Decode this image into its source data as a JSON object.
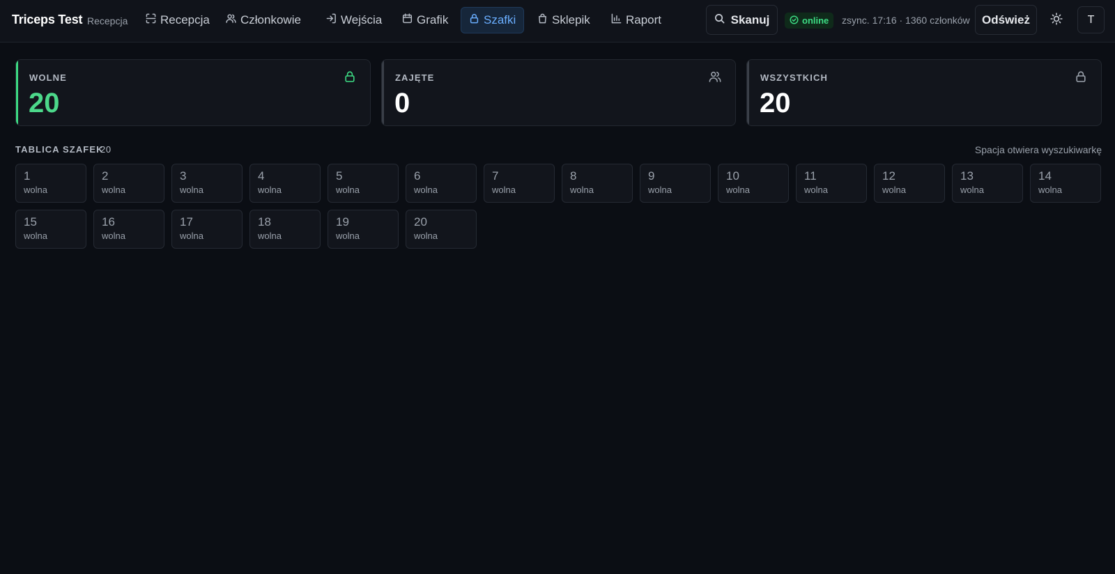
{
  "app": {
    "title": "Triceps Test",
    "subtitle": "Recepcja"
  },
  "nav": [
    {
      "label": "Recepcja",
      "icon": "scan-icon",
      "active": false
    },
    {
      "label": "Członkowie",
      "icon": "users-icon",
      "active": false
    },
    {
      "label": "Wejścia",
      "icon": "login-arrow-icon",
      "active": false
    },
    {
      "label": "Grafik",
      "icon": "calendar-icon",
      "active": false
    },
    {
      "label": "Szafki",
      "icon": "lock-icon",
      "active": true
    },
    {
      "label": "Sklepik",
      "icon": "shopping-bag-icon",
      "active": false
    },
    {
      "label": "Raport",
      "icon": "bar-chart-icon",
      "active": false
    }
  ],
  "header": {
    "scan_label": "Skanuj",
    "status_label": "online",
    "sync_text": "zsync. 17:16 · 1360 członków",
    "refresh_label": "Odśwież",
    "avatar_initial": "T"
  },
  "stats": [
    {
      "label": "WOLNE",
      "value": "20",
      "icon": "lock-open-icon",
      "accent": "#3ddc84",
      "value_color": "#4cd88a"
    },
    {
      "label": "ZAJĘTE",
      "value": "0",
      "icon": "users-icon",
      "accent": "#3a3f48",
      "value_color": "#ffffff"
    },
    {
      "label": "WSZYSTKICH",
      "value": "20",
      "icon": "lock-icon",
      "accent": "#3a3f48",
      "value_color": "#ffffff"
    }
  ],
  "board": {
    "title": "TABLICA SZAFEK",
    "count": "20",
    "hint": "Spacja otwiera wyszukiwarkę",
    "lockers": [
      {
        "number": "1",
        "status": "wolna"
      },
      {
        "number": "2",
        "status": "wolna"
      },
      {
        "number": "3",
        "status": "wolna"
      },
      {
        "number": "4",
        "status": "wolna"
      },
      {
        "number": "5",
        "status": "wolna"
      },
      {
        "number": "6",
        "status": "wolna"
      },
      {
        "number": "7",
        "status": "wolna"
      },
      {
        "number": "8",
        "status": "wolna"
      },
      {
        "number": "9",
        "status": "wolna"
      },
      {
        "number": "10",
        "status": "wolna"
      },
      {
        "number": "11",
        "status": "wolna"
      },
      {
        "number": "12",
        "status": "wolna"
      },
      {
        "number": "13",
        "status": "wolna"
      },
      {
        "number": "14",
        "status": "wolna"
      },
      {
        "number": "15",
        "status": "wolna"
      },
      {
        "number": "16",
        "status": "wolna"
      },
      {
        "number": "17",
        "status": "wolna"
      },
      {
        "number": "18",
        "status": "wolna"
      },
      {
        "number": "19",
        "status": "wolna"
      },
      {
        "number": "20",
        "status": "wolna"
      }
    ]
  }
}
